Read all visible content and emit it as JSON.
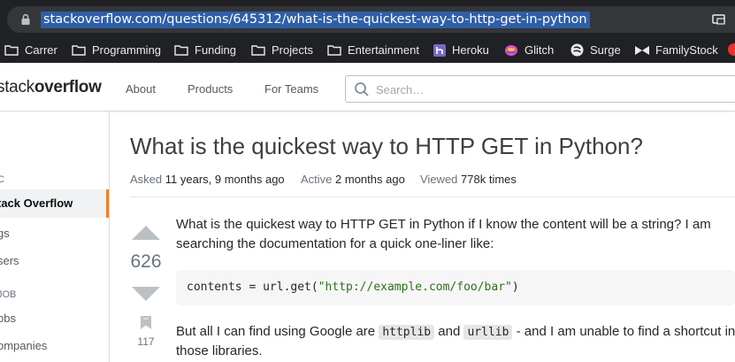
{
  "browser": {
    "url": "stackoverflow.com/questions/645312/what-is-the-quickest-way-to-http-get-in-python",
    "bookmarks": [
      {
        "label": "Carrer",
        "icon": "folder-icon"
      },
      {
        "label": "Programming",
        "icon": "folder-icon"
      },
      {
        "label": "Funding",
        "icon": "folder-icon"
      },
      {
        "label": "Projects",
        "icon": "folder-icon"
      },
      {
        "label": "Entertainment",
        "icon": "folder-icon"
      },
      {
        "label": "Heroku",
        "icon": "heroku-icon"
      },
      {
        "label": "Glitch",
        "icon": "glitch-icon"
      },
      {
        "label": "Surge",
        "icon": "surge-icon"
      },
      {
        "label": "FamilyStock",
        "icon": "familystock-icon"
      }
    ]
  },
  "header": {
    "logo_light": "stack",
    "logo_bold": "overflow",
    "nav": [
      "About",
      "Products",
      "For Teams"
    ],
    "search_placeholder": "Search…"
  },
  "sidebar": {
    "section_public": "C",
    "active": "tack Overflow",
    "items": [
      "gs",
      "sers"
    ],
    "section_jobs": "JOB",
    "jobs_items": [
      "obs",
      "ompanies"
    ]
  },
  "question": {
    "title": "What is the quickest way to HTTP GET in Python?",
    "meta": {
      "asked_label": "Asked",
      "asked_value": "11 years, 9 months ago",
      "active_label": "Active",
      "active_value": "2 months ago",
      "viewed_label": "Viewed",
      "viewed_value": "778k times"
    },
    "votes": "626",
    "bookmarks": "117",
    "body_line1": "What is the quickest way to HTTP GET in Python if I know the content will be a string? I am",
    "body_line2": "searching the documentation for a quick one-liner like:",
    "code_prefix": "contents = url.get(",
    "code_string": "\"http://example.com/foo/bar\"",
    "code_suffix": ")",
    "body2_a": "But all I can find using Google are ",
    "code_httplib": "httplib",
    "body2_b": " and ",
    "code_urllib": "urllib",
    "body2_c": " - and I am unable to find a shortcut in",
    "body2_line2": "those libraries."
  },
  "colors": {
    "accent": "#f48024",
    "browser_bg": "#202124",
    "url_highlight": "#2f5fa7"
  }
}
